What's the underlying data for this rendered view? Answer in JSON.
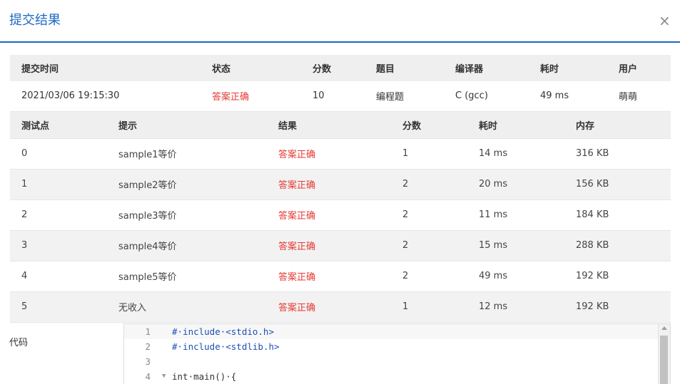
{
  "dialog": {
    "title": "提交结果",
    "close_label": "×"
  },
  "summary": {
    "headers": [
      "提交时间",
      "状态",
      "分数",
      "题目",
      "编译器",
      "耗时",
      "用户"
    ],
    "row": [
      "2021/03/06 19:15:30",
      "答案正确",
      "10",
      "编程题",
      "C (gcc)",
      "49 ms",
      "萌萌"
    ]
  },
  "cases": {
    "headers": [
      "测试点",
      "提示",
      "结果",
      "分数",
      "耗时",
      "内存"
    ],
    "rows": [
      [
        "0",
        "sample1等价",
        "答案正确",
        "1",
        "14 ms",
        "316 KB"
      ],
      [
        "1",
        "sample2等价",
        "答案正确",
        "2",
        "20 ms",
        "156 KB"
      ],
      [
        "2",
        "sample3等价",
        "答案正确",
        "2",
        "11 ms",
        "184 KB"
      ],
      [
        "3",
        "sample4等价",
        "答案正确",
        "2",
        "15 ms",
        "288 KB"
      ],
      [
        "4",
        "sample5等价",
        "答案正确",
        "2",
        "49 ms",
        "192 KB"
      ],
      [
        "5",
        "无收入",
        "答案正确",
        "1",
        "12 ms",
        "192 KB"
      ]
    ]
  },
  "code": {
    "label": "代码",
    "lines": [
      {
        "num": "1",
        "text": "#·include·<stdio.h>"
      },
      {
        "num": "2",
        "text": "#·include·<stdlib.h>"
      },
      {
        "num": "3",
        "text": ""
      },
      {
        "num": "4",
        "text": "int·main()·{"
      }
    ]
  },
  "colors": {
    "accent": "#1e68c6",
    "status_ok": "#e53935"
  }
}
